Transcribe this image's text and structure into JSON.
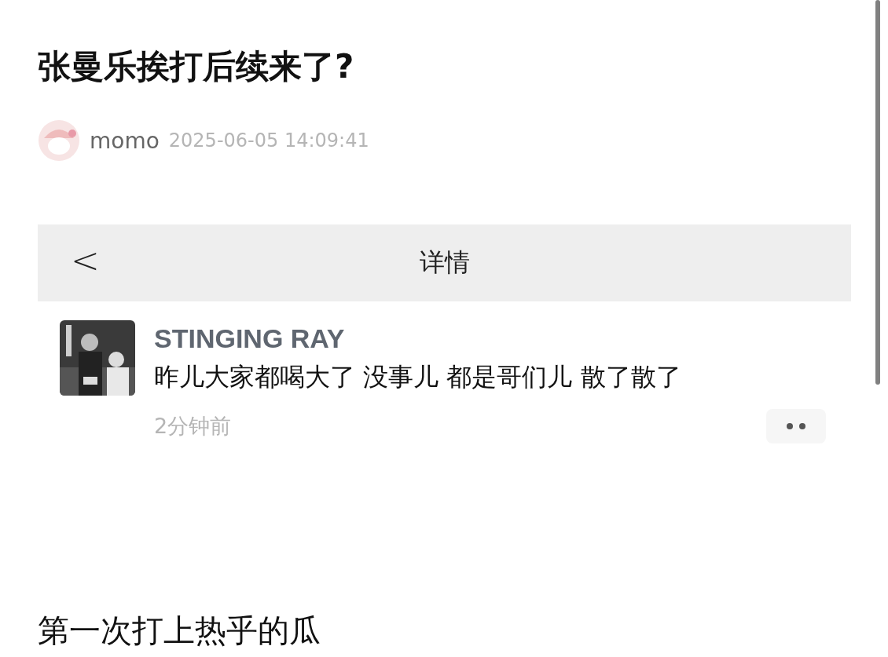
{
  "post": {
    "title": "张曼乐挨打后续来了?",
    "author": "momo",
    "timestamp": "2025-06-05 14:09:41"
  },
  "screenshot": {
    "header": {
      "back": "<",
      "title": "详情"
    },
    "comment": {
      "username": "STINGING RAY",
      "text": "昨儿大家都喝大了 没事儿 都是哥们儿 散了散了",
      "time": "2分钟前"
    }
  },
  "body_text": "第一次打上热乎的瓜"
}
